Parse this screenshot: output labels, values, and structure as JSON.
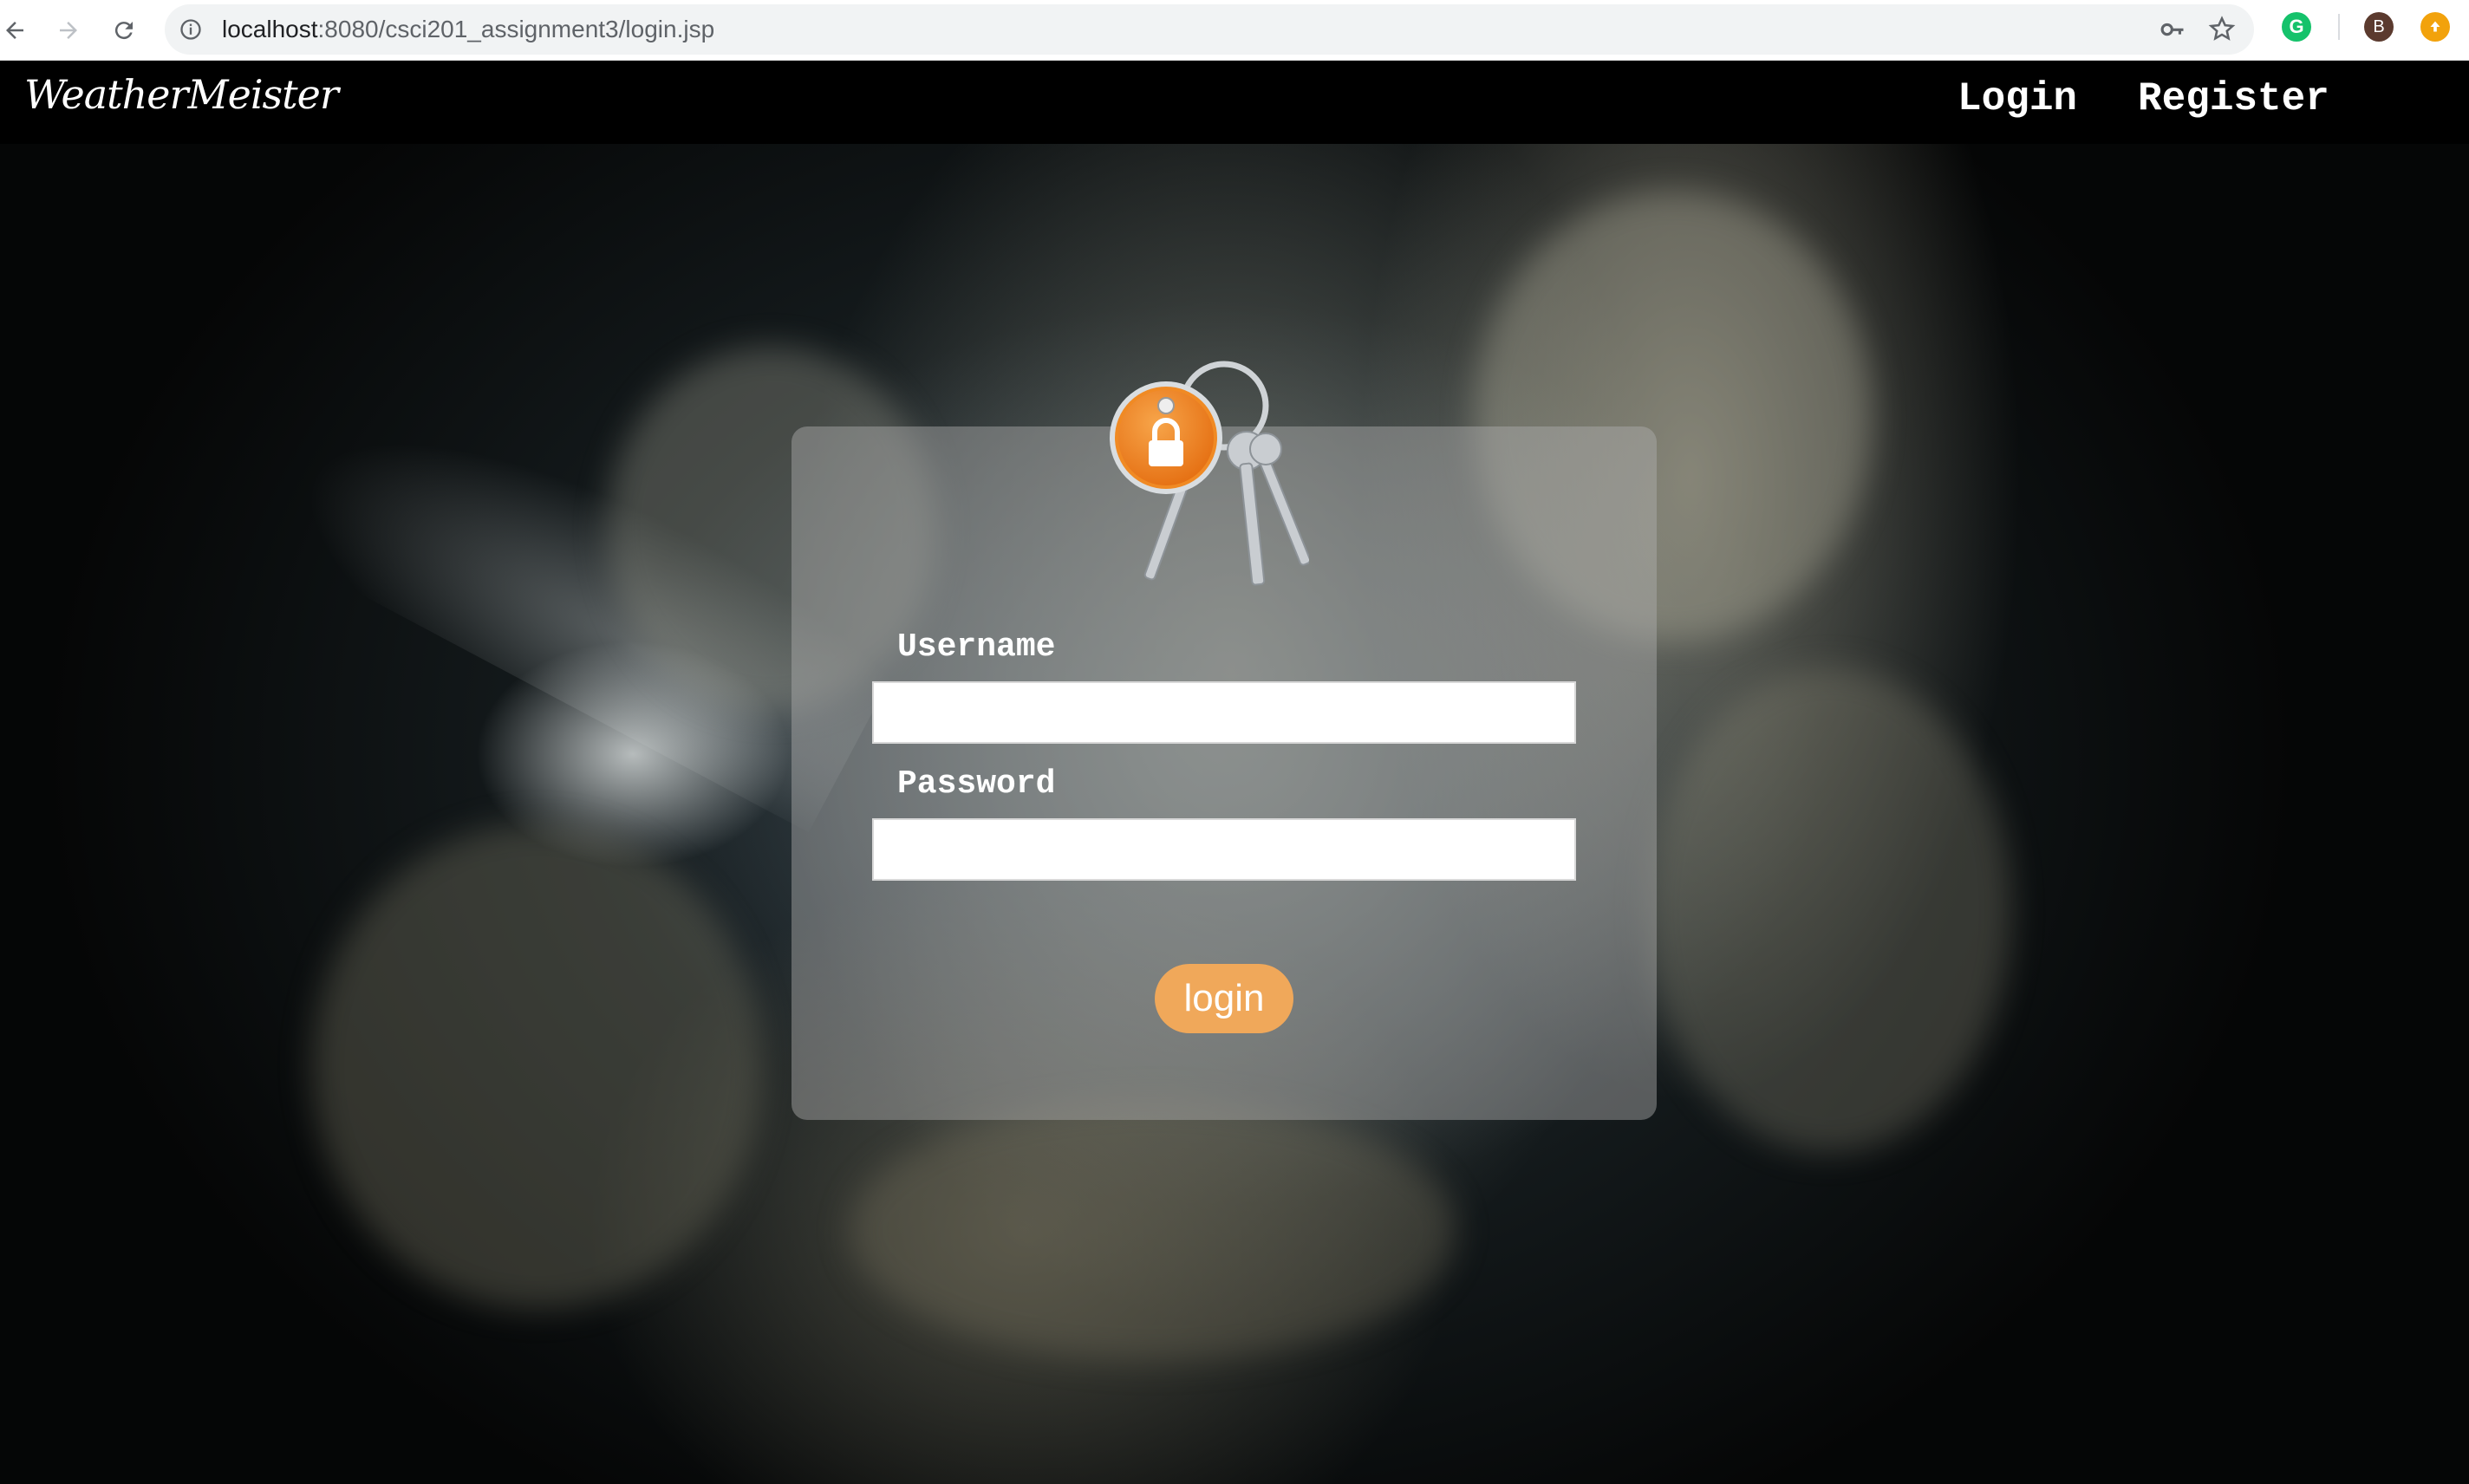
{
  "browser": {
    "url_host": "localhost",
    "url_rest": ":8080/csci201_assignment3/login.jsp",
    "profile_initial": "B"
  },
  "header": {
    "brand": "WeatherMeister",
    "nav": [
      {
        "label": "Login"
      },
      {
        "label": "Register"
      }
    ]
  },
  "login_form": {
    "username_label": "Username",
    "username_value": "",
    "password_label": "Password",
    "password_value": "",
    "submit_label": "login"
  },
  "colors": {
    "button": "#f0a85a",
    "topbar": "#000000",
    "lock_badge": "#f08a24"
  }
}
